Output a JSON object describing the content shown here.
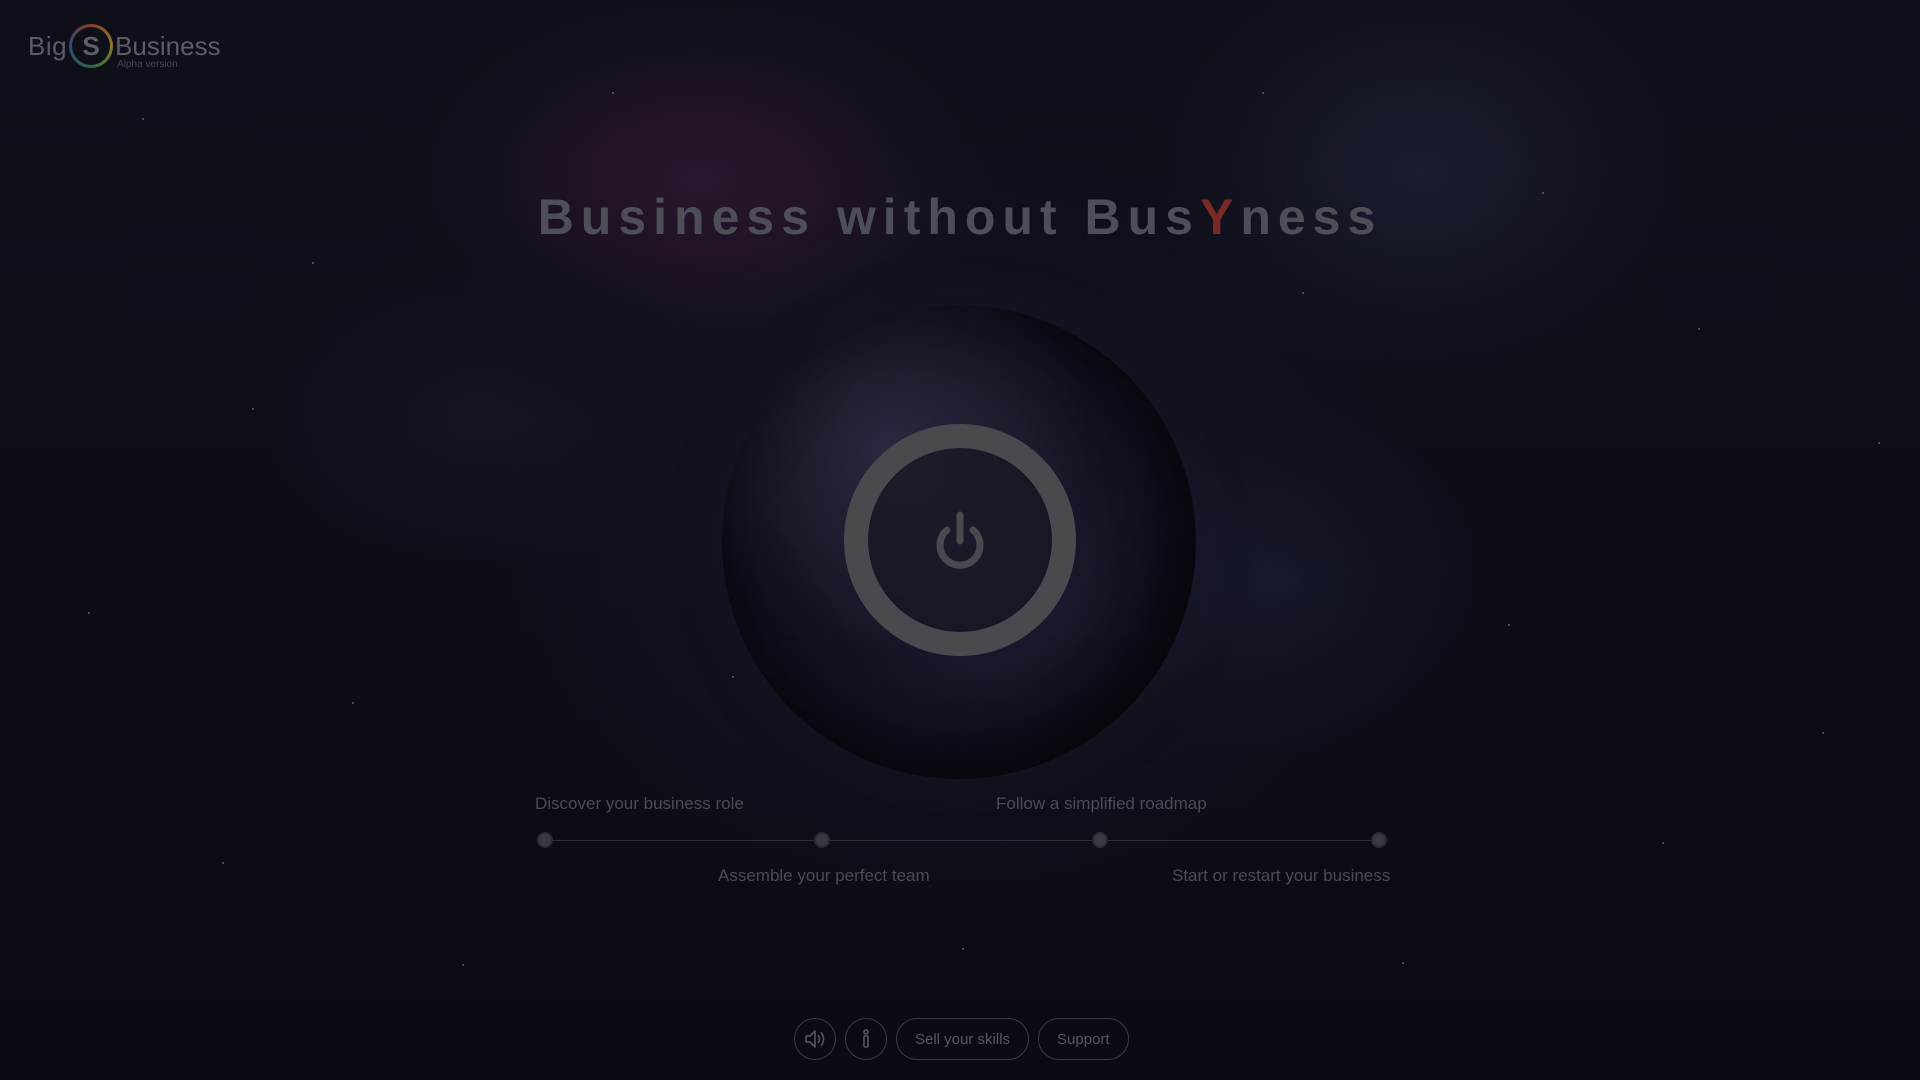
{
  "logo": {
    "left_text": "Big",
    "ring_letter": "S",
    "right_text": "Business",
    "subtitle": "Alpha version"
  },
  "headline": {
    "part1": "Business without Bus",
    "accent": "Y",
    "part2": "ness",
    "accent_color": "#7a2a24"
  },
  "power_button": {
    "icon": "power-icon"
  },
  "roadmap": {
    "steps": [
      {
        "label": "Discover your business role"
      },
      {
        "label": "Assemble your perfect team"
      },
      {
        "label": "Follow a simplified roadmap"
      },
      {
        "label": "Start or restart your business"
      }
    ]
  },
  "toolbar": {
    "sound_icon": "speaker-icon",
    "info_icon": "info-icon",
    "sell_skills_label": "Sell your skills",
    "support_label": "Support"
  }
}
